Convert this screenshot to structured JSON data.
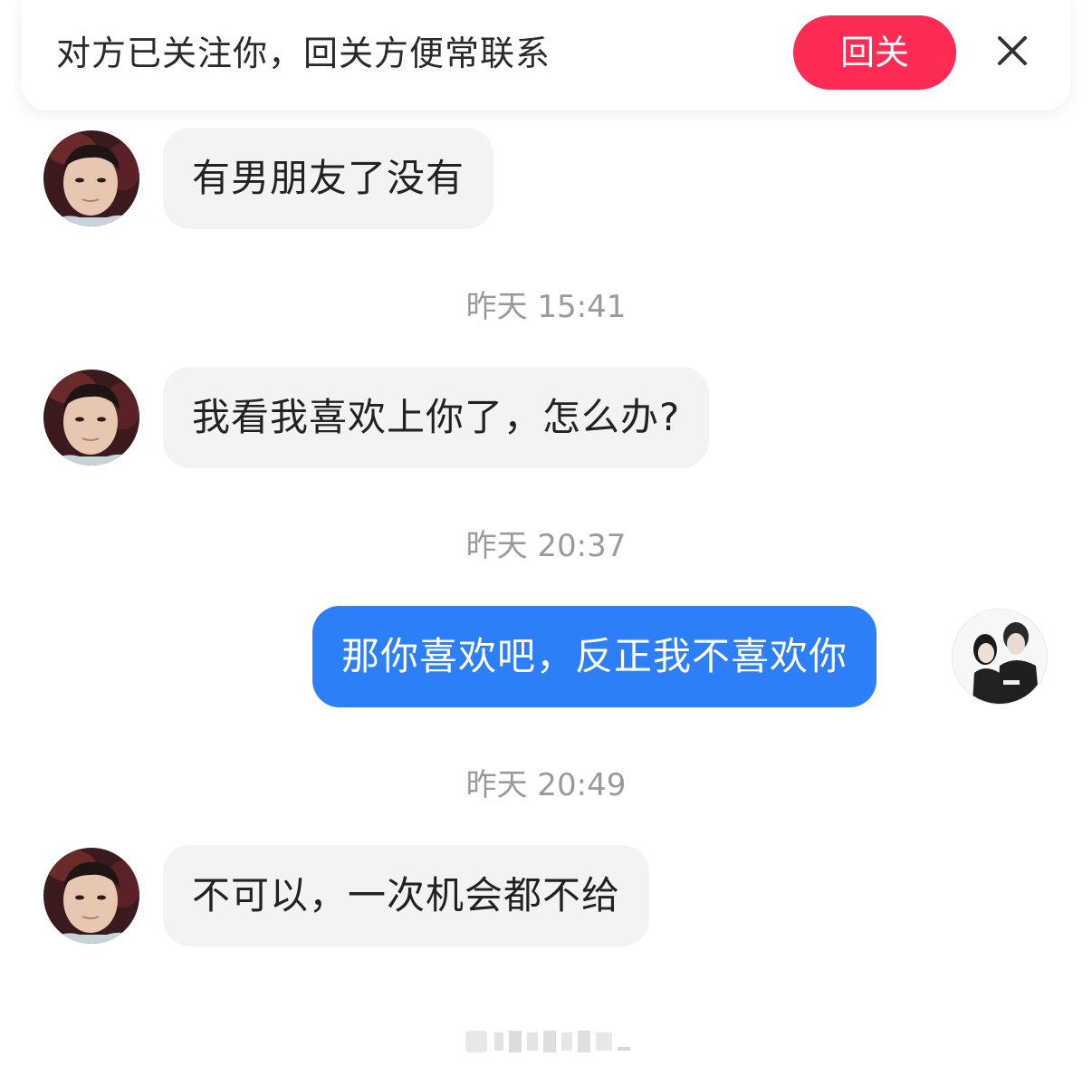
{
  "banner": {
    "text": "对方已关注你，回关方便常联系",
    "follow_back_label": "回关",
    "close_icon": "close-icon"
  },
  "messages": [
    {
      "sender": "other",
      "text": "有男朋友了没有"
    },
    {
      "sender": "other",
      "text": "我看我喜欢上你了，怎么办?"
    },
    {
      "sender": "me",
      "text": "那你喜欢吧，反正我不喜欢你"
    },
    {
      "sender": "other",
      "text": "不可以，一次机会都不给"
    }
  ],
  "timestamps": [
    "昨天 15:41",
    "昨天 20:37",
    "昨天 20:49"
  ],
  "colors": {
    "follow_button": "#fe2c55",
    "outgoing_bubble": "#2d7ff9",
    "incoming_bubble": "#f3f3f4",
    "timestamp_text": "#9a9a9a"
  }
}
